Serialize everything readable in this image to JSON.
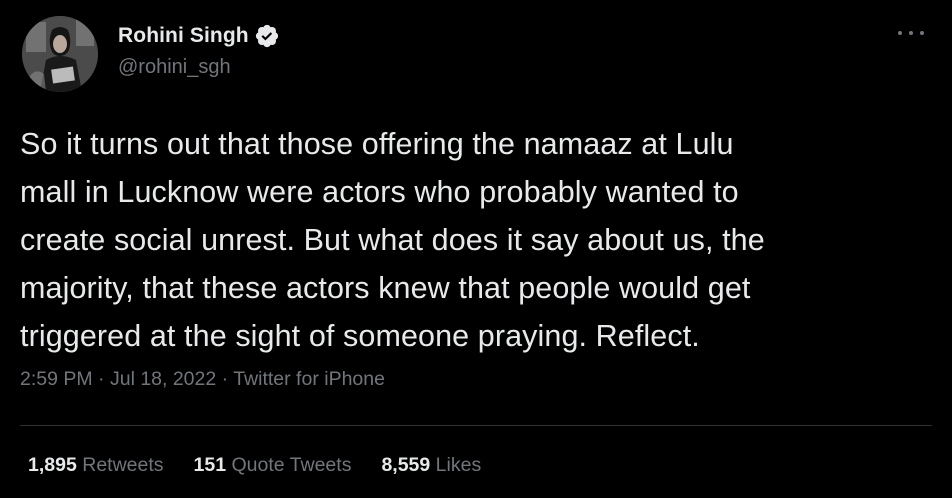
{
  "author": {
    "display_name": "Rohini Singh",
    "handle": "@rohini_sgh",
    "verified_icon": "verified-badge-icon",
    "avatar": "profile-photo"
  },
  "more_icon": "more-horizontal-icon",
  "tweet": {
    "lines": [
      "So it turns out that those offering the namaaz at Lulu",
      "mall in Lucknow were actors who probably wanted to",
      "create social unrest. But what does it say about us, the",
      "majority, that these actors knew that people would get",
      "triggered at the sight of someone praying. Reflect."
    ]
  },
  "meta": {
    "time": "2:59 PM",
    "sep1": " · ",
    "date": "Jul 18, 2022",
    "sep2": " · ",
    "source": "Twitter for iPhone"
  },
  "stats": {
    "retweets_count": "1,895",
    "retweets_label": " Retweets",
    "quotes_count": "151",
    "quotes_label": " Quote Tweets",
    "likes_count": "8,559",
    "likes_label": " Likes"
  },
  "colors": {
    "background": "#000000",
    "text_primary": "#e7e9ea",
    "text_secondary": "#71767b",
    "divider": "#2f3336"
  }
}
